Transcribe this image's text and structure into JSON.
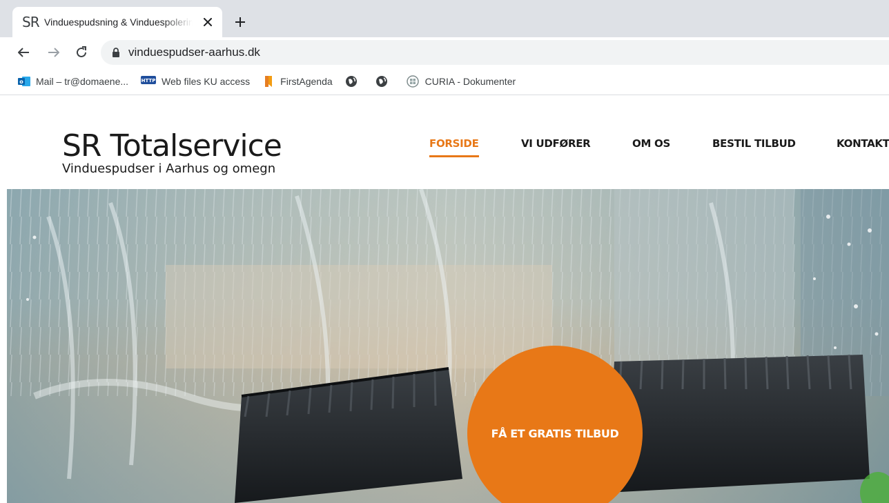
{
  "browser": {
    "tab": {
      "favicon_text": "SR",
      "title": "Vinduespudsning & Vinduespolering",
      "close_icon": "close-icon"
    },
    "new_tab_icon": "plus-icon",
    "nav_icons": [
      "back-arrow-icon",
      "forward-arrow-icon",
      "reload-icon"
    ],
    "address": {
      "url": "vinduespudser-aarhus.dk",
      "icon": "lock-icon"
    },
    "bookmarks": [
      {
        "label": "Mail – tr@domaene...",
        "icon": "outlook-icon"
      },
      {
        "label": "Web files KU access",
        "icon": "web-files-icon"
      },
      {
        "label": "FirstAgenda",
        "icon": "firstagenda-icon"
      },
      {
        "label": "",
        "icon": "globe-icon"
      },
      {
        "label": "",
        "icon": "globe-icon"
      },
      {
        "label": "CURIA - Dokumenter",
        "icon": "curia-icon"
      }
    ]
  },
  "site": {
    "logo_title": "SR Totalservice",
    "logo_subtitle": "Vinduespudser i Aarhus og omegn",
    "nav": [
      {
        "label": "FORSIDE",
        "active": true
      },
      {
        "label": "VI UDFØRER",
        "active": false
      },
      {
        "label": "OM OS",
        "active": false
      },
      {
        "label": "BESTIL TILBUD",
        "active": false
      },
      {
        "label": "KONTAKT",
        "active": false
      }
    ],
    "cta_label": "FÅ ET GRATIS TILBUD"
  },
  "colors": {
    "accent": "#e87817",
    "tabstrip": "#dee1e6",
    "omnibox": "#f1f3f4"
  }
}
